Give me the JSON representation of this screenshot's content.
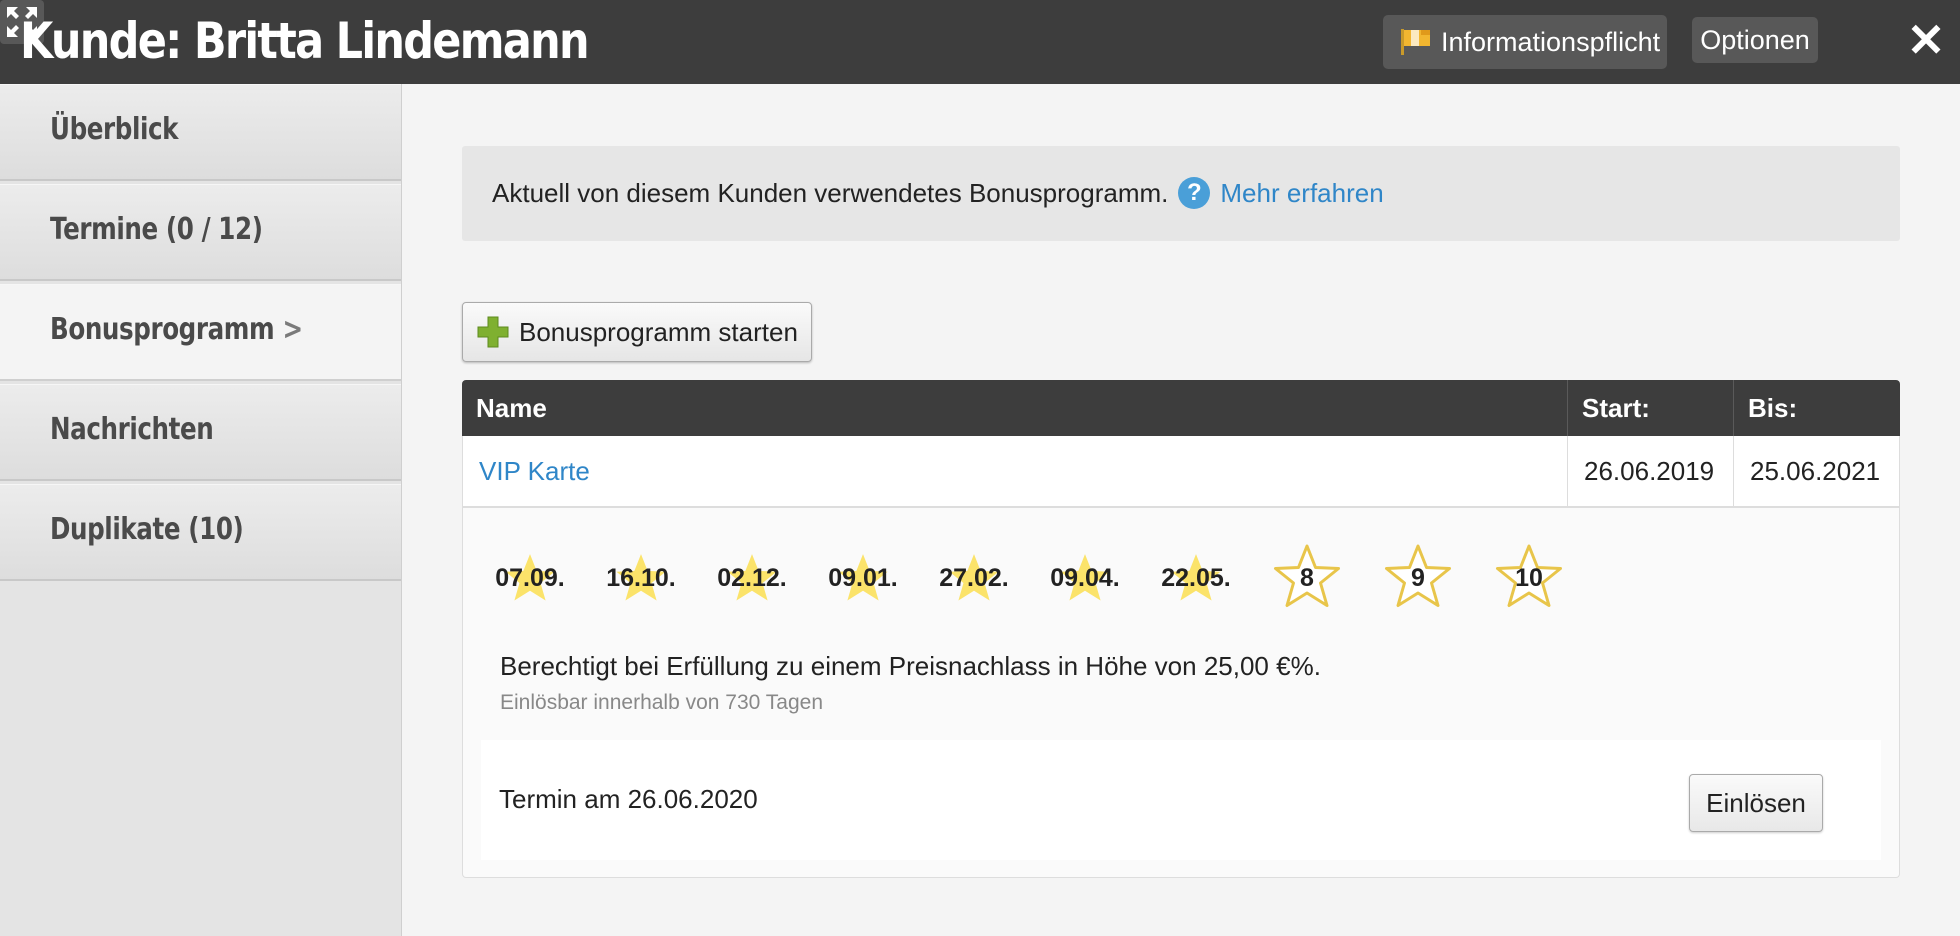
{
  "window": {
    "title": "Kunde: Britta Lindemann",
    "info_button": "Informationspflicht",
    "options_button": "Optionen",
    "close_symbol": "✕"
  },
  "sidebar": {
    "items": [
      {
        "label": "Überblick"
      },
      {
        "label": "Termine (0 / 12)"
      },
      {
        "label": "Bonusprogramm",
        "chevron": ">"
      },
      {
        "label": "Nachrichten"
      },
      {
        "label": "Duplikate (10)"
      }
    ],
    "active_index": 2
  },
  "info": {
    "text": "Aktuell von diesem Kunden verwendetes Bonusprogramm.",
    "help_symbol": "?",
    "link": "Mehr erfahren"
  },
  "start_button": {
    "label": "Bonusprogramm starten"
  },
  "table": {
    "headers": {
      "name": "Name",
      "start": "Start:",
      "end": "Bis:"
    },
    "row": {
      "name": "VIP Karte",
      "start": "26.06.2019",
      "end": "25.06.2021"
    }
  },
  "stamps": [
    {
      "label": "07.09.",
      "collected": true
    },
    {
      "label": "16.10.",
      "collected": true
    },
    {
      "label": "02.12.",
      "collected": true
    },
    {
      "label": "09.01.",
      "collected": true
    },
    {
      "label": "27.02.",
      "collected": true
    },
    {
      "label": "09.04.",
      "collected": true
    },
    {
      "label": "22.05.",
      "collected": true
    },
    {
      "label": "8",
      "collected": false
    },
    {
      "label": "9",
      "collected": false
    },
    {
      "label": "10",
      "collected": false
    }
  ],
  "reward": {
    "text": "Berechtigt bei Erfüllung zu einem Preisnachlass in Höhe von 25,00 €%.",
    "redeemable": "Einlösbar innerhalb von 730 Tagen"
  },
  "appointment": {
    "text": "Termin am 26.06.2020",
    "redeem_button": "Einlösen"
  },
  "colors": {
    "header_bg": "#3d3d3d",
    "link": "#2f86c8",
    "star_fill": "#fbe36a",
    "star_outline": "#e8c54a",
    "plus_green": "#7fb030"
  }
}
